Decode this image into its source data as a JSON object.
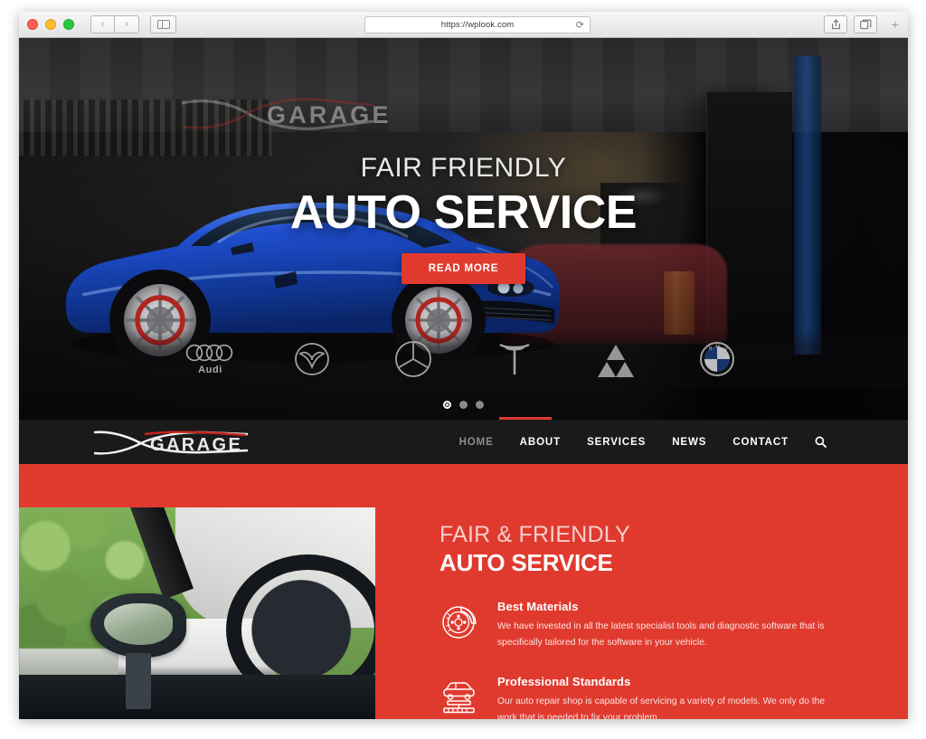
{
  "browser": {
    "url": "https://wplook.com",
    "back_label": "‹",
    "forward_label": "›",
    "reload_label": "⟳",
    "new_tab_label": "+",
    "icons": {
      "sidebar": "sidebar-icon",
      "share": "share-icon",
      "tabs": "tabs-icon",
      "reload": "reload-icon"
    }
  },
  "hero": {
    "watermark": "GARAGE",
    "subtitle": "FAIR FRIENDLY",
    "title": "AUTO SERVICE",
    "cta_label": "READ MORE",
    "brands": [
      {
        "name": "Audi",
        "label": "Audi"
      },
      {
        "name": "Mazda",
        "label": ""
      },
      {
        "name": "Mercedes-Benz",
        "label": ""
      },
      {
        "name": "Tesla",
        "label": ""
      },
      {
        "name": "Mitsubishi",
        "label": ""
      },
      {
        "name": "BMW",
        "label": ""
      }
    ],
    "slides": [
      {
        "active": true
      },
      {
        "active": false
      },
      {
        "active": false
      }
    ]
  },
  "navbar": {
    "logo_text": "GARAGE",
    "items": [
      {
        "label": "HOME",
        "active": true
      },
      {
        "label": "ABOUT",
        "active": false
      },
      {
        "label": "SERVICES",
        "active": false
      },
      {
        "label": "NEWS",
        "active": false
      },
      {
        "label": "CONTACT",
        "active": false
      }
    ],
    "search_icon": "search-icon"
  },
  "red_section": {
    "subtitle": "FAIR & FRIENDLY",
    "title": "AUTO SERVICE",
    "features": [
      {
        "icon": "brake-disc-icon",
        "title": "Best Materials",
        "desc": "We have invested in all the latest specialist tools and diagnostic software that is specifically tailored for the software in your vehicle."
      },
      {
        "icon": "car-lift-icon",
        "title": "Professional Standards",
        "desc": "Our auto repair shop is capable of servicing a variety of models. We only do the work that is needed to fix your problem."
      }
    ]
  },
  "colors": {
    "accent_red": "#e03a2f",
    "nav_background": "#1a1a1a",
    "hero_background": "#1e1e20"
  }
}
